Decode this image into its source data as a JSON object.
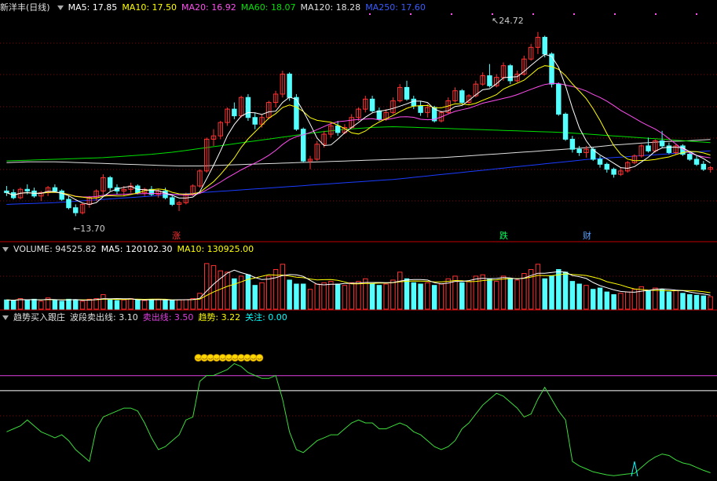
{
  "colors": {
    "up": "#ff3232",
    "down": "#54ffff",
    "ma5": "#ffffff",
    "ma10": "#ffff00",
    "ma20": "#ff4ef0",
    "ma60": "#00e000",
    "ma120": "#e0e0e0",
    "ma250": "#1a3cff",
    "osc": "#3cdc3c",
    "sell": "#e040e0",
    "trend": "#ffff00",
    "watch": "#00ffff",
    "grid": "#8b0000",
    "sep": "#c00000",
    "marker": "#ffd700"
  },
  "price_header": {
    "stock": "新洋丰(日线)",
    "ma5": "MA5: 17.85",
    "ma10": "MA10: 17.50",
    "ma20": "MA20: 16.92",
    "ma60": "MA60: 18.07",
    "ma120": "MA120: 18.28",
    "ma250": "MA250: 17.60"
  },
  "volume_header": {
    "name": "VOLUME: 94525.82",
    "ma5": "MA5: 120102.30",
    "ma10": "MA10: 130925.00"
  },
  "indicator_header": {
    "name": "趋势买入跟庄",
    "wave_sell": "波段卖出线: 3.10",
    "sell_line": "卖出线: 3.50",
    "trend": "趋势: 3.22",
    "watch": "关注: 0.00"
  },
  "annotations": {
    "high": "24.72",
    "low": "13.70",
    "zhang": "涨",
    "die": "跌",
    "cai": "财"
  },
  "chart_data": [
    {
      "type": "candlestick",
      "note_series": "daily OHLC, oldest to newest",
      "ylim": [
        13.2,
        25.6
      ],
      "high_label": 24.72,
      "low_label": 13.7,
      "ohlc": [
        [
          15.2,
          15.5,
          14.9,
          15.1
        ],
        [
          15.1,
          15.3,
          14.7,
          14.8
        ],
        [
          14.8,
          15.4,
          14.7,
          15.3
        ],
        [
          15.3,
          15.6,
          15.0,
          15.2
        ],
        [
          15.2,
          15.4,
          14.8,
          14.9
        ],
        [
          14.9,
          15.2,
          14.6,
          15.1
        ],
        [
          15.1,
          15.5,
          14.9,
          15.4
        ],
        [
          15.4,
          15.6,
          15.1,
          15.2
        ],
        [
          15.2,
          15.3,
          14.6,
          14.7
        ],
        [
          14.7,
          14.9,
          14.1,
          14.2
        ],
        [
          14.2,
          14.4,
          13.7,
          13.9
        ],
        [
          13.9,
          14.5,
          13.8,
          14.4
        ],
        [
          14.4,
          14.9,
          14.2,
          14.8
        ],
        [
          14.8,
          15.3,
          14.6,
          15.2
        ],
        [
          15.2,
          16.2,
          15.0,
          16.0
        ],
        [
          16.0,
          16.1,
          15.2,
          15.4
        ],
        [
          15.4,
          15.6,
          15.0,
          15.2
        ],
        [
          15.2,
          15.5,
          14.9,
          15.3
        ],
        [
          15.3,
          15.7,
          15.1,
          15.5
        ],
        [
          15.5,
          15.6,
          15.0,
          15.1
        ],
        [
          15.1,
          15.4,
          14.9,
          15.3
        ],
        [
          15.3,
          15.5,
          14.9,
          15.0
        ],
        [
          15.0,
          15.3,
          14.8,
          15.2
        ],
        [
          15.2,
          15.4,
          14.7,
          14.8
        ],
        [
          14.8,
          14.9,
          14.3,
          14.4
        ],
        [
          14.4,
          14.6,
          14.0,
          14.5
        ],
        [
          14.5,
          15.1,
          14.4,
          15.0
        ],
        [
          15.0,
          15.6,
          14.9,
          15.5
        ],
        [
          15.5,
          16.5,
          15.4,
          16.4
        ],
        [
          16.4,
          18.4,
          16.3,
          18.3
        ],
        [
          18.3,
          18.9,
          17.9,
          18.5
        ],
        [
          18.5,
          19.4,
          18.3,
          19.3
        ],
        [
          19.3,
          20.2,
          19.1,
          20.1
        ],
        [
          20.1,
          20.5,
          19.5,
          19.7
        ],
        [
          19.7,
          20.9,
          19.6,
          20.8
        ],
        [
          20.8,
          21.0,
          19.4,
          19.6
        ],
        [
          19.6,
          19.9,
          18.9,
          19.2
        ],
        [
          19.2,
          19.8,
          19.0,
          19.6
        ],
        [
          19.6,
          20.6,
          19.5,
          20.5
        ],
        [
          20.5,
          21.2,
          20.2,
          21.0
        ],
        [
          21.0,
          22.4,
          20.8,
          22.2
        ],
        [
          22.2,
          22.3,
          20.6,
          20.8
        ],
        [
          20.8,
          21.0,
          18.8,
          18.9
        ],
        [
          18.9,
          19.0,
          16.9,
          17.0
        ],
        [
          17.0,
          17.3,
          16.5,
          17.1
        ],
        [
          17.1,
          18.2,
          17.0,
          18.0
        ],
        [
          18.0,
          18.8,
          17.8,
          18.6
        ],
        [
          18.6,
          19.3,
          18.4,
          19.1
        ],
        [
          19.1,
          19.4,
          18.5,
          18.7
        ],
        [
          18.7,
          19.2,
          18.6,
          19.0
        ],
        [
          19.0,
          19.8,
          18.9,
          19.6
        ],
        [
          19.6,
          20.2,
          19.4,
          20.1
        ],
        [
          20.1,
          20.9,
          19.9,
          20.7
        ],
        [
          20.7,
          20.9,
          19.9,
          20.0
        ],
        [
          20.0,
          20.2,
          19.4,
          19.5
        ],
        [
          19.5,
          20.1,
          19.4,
          19.9
        ],
        [
          19.9,
          20.8,
          19.8,
          20.6
        ],
        [
          20.6,
          21.6,
          20.5,
          21.4
        ],
        [
          21.4,
          21.8,
          20.6,
          20.7
        ],
        [
          20.7,
          20.9,
          20.1,
          20.3
        ],
        [
          20.3,
          20.6,
          19.7,
          19.9
        ],
        [
          19.9,
          20.4,
          19.6,
          20.2
        ],
        [
          20.2,
          20.3,
          19.3,
          19.4
        ],
        [
          19.4,
          20.0,
          19.3,
          19.9
        ],
        [
          19.9,
          20.8,
          19.8,
          20.6
        ],
        [
          20.6,
          21.4,
          20.5,
          21.2
        ],
        [
          21.2,
          21.3,
          20.4,
          20.5
        ],
        [
          20.5,
          21.0,
          20.4,
          20.9
        ],
        [
          20.9,
          21.8,
          20.8,
          21.6
        ],
        [
          21.6,
          22.3,
          21.5,
          22.1
        ],
        [
          22.1,
          22.8,
          21.4,
          21.5
        ],
        [
          21.5,
          22.2,
          21.4,
          22.0
        ],
        [
          22.0,
          22.9,
          21.8,
          22.7
        ],
        [
          22.7,
          22.8,
          21.6,
          21.8
        ],
        [
          21.8,
          22.4,
          21.7,
          22.2
        ],
        [
          22.2,
          23.3,
          22.1,
          23.1
        ],
        [
          23.1,
          24.0,
          23.0,
          23.8
        ],
        [
          23.8,
          24.72,
          23.4,
          24.4
        ],
        [
          24.4,
          24.5,
          23.2,
          23.4
        ],
        [
          23.4,
          23.5,
          21.4,
          21.6
        ],
        [
          21.6,
          21.7,
          19.7,
          19.8
        ],
        [
          19.8,
          19.9,
          18.2,
          18.3
        ],
        [
          18.3,
          18.5,
          17.5,
          17.7
        ],
        [
          17.7,
          17.9,
          17.3,
          17.5
        ],
        [
          17.5,
          17.9,
          17.2,
          17.7
        ],
        [
          17.7,
          17.8,
          17.0,
          17.1
        ],
        [
          17.1,
          17.3,
          16.6,
          16.8
        ],
        [
          16.8,
          16.9,
          16.3,
          16.5
        ],
        [
          16.5,
          16.6,
          16.0,
          16.2
        ],
        [
          16.2,
          16.6,
          16.1,
          16.4
        ],
        [
          16.4,
          17.0,
          16.3,
          16.9
        ],
        [
          16.9,
          17.4,
          16.8,
          17.3
        ],
        [
          17.3,
          18.0,
          17.2,
          17.9
        ],
        [
          17.9,
          18.4,
          17.5,
          17.6
        ],
        [
          17.6,
          18.3,
          17.5,
          18.2
        ],
        [
          18.2,
          18.8,
          17.8,
          17.9
        ],
        [
          17.9,
          18.1,
          17.4,
          17.5
        ],
        [
          17.5,
          18.0,
          17.4,
          17.9
        ],
        [
          17.9,
          18.0,
          17.3,
          17.4
        ],
        [
          17.4,
          17.6,
          17.0,
          17.1
        ],
        [
          17.1,
          17.3,
          16.7,
          16.8
        ],
        [
          16.8,
          17.0,
          16.4,
          16.5
        ],
        [
          16.5,
          16.7,
          16.3,
          16.6
        ]
      ],
      "ma_windows": {
        "ma5": 5,
        "ma10": 10,
        "ma20": 20
      },
      "ma60": [
        17.0,
        17.05,
        17.1,
        17.15,
        17.2,
        17.3,
        17.4,
        17.55,
        17.75,
        17.95,
        18.15,
        18.35,
        18.55,
        18.75,
        18.9,
        19.0,
        19.05,
        19.0,
        18.95,
        18.9,
        18.85,
        18.8,
        18.75,
        18.7,
        18.6,
        18.5,
        18.4,
        18.3,
        18.2,
        18.1
      ],
      "ma120": [
        16.9,
        16.95,
        16.95,
        16.9,
        16.85,
        16.8,
        16.75,
        16.7,
        16.7,
        16.75,
        16.8,
        16.85,
        16.9,
        16.95,
        17.0,
        17.05,
        17.1,
        17.15,
        17.2,
        17.3,
        17.4,
        17.5,
        17.6,
        17.7,
        17.8,
        17.95,
        18.05,
        18.15,
        18.2,
        18.28
      ],
      "ma250": [
        14.4,
        14.45,
        14.5,
        14.6,
        14.7,
        14.8,
        14.9,
        15.0,
        15.1,
        15.2,
        15.3,
        15.4,
        15.5,
        15.6,
        15.7,
        15.8,
        15.9,
        16.05,
        16.2,
        16.35,
        16.5,
        16.65,
        16.8,
        16.95,
        17.1,
        17.2,
        17.3,
        17.4,
        17.5,
        17.6
      ]
    },
    {
      "type": "bar",
      "title": "VOLUME",
      "ylim": [
        0,
        380000
      ],
      "values": [
        70000,
        65000,
        80000,
        70000,
        75000,
        60000,
        85000,
        70000,
        60000,
        75000,
        72000,
        60000,
        75000,
        80000,
        110000,
        70000,
        65000,
        70000,
        80000,
        70000,
        65000,
        70000,
        75000,
        72000,
        68000,
        70000,
        72000,
        80000,
        120000,
        345000,
        330000,
        290000,
        280000,
        230000,
        250000,
        260000,
        180000,
        200000,
        250000,
        300000,
        340000,
        220000,
        190000,
        190000,
        150000,
        190000,
        200000,
        210000,
        190000,
        180000,
        200000,
        210000,
        230000,
        190000,
        180000,
        190000,
        220000,
        280000,
        230000,
        200000,
        190000,
        200000,
        180000,
        190000,
        230000,
        250000,
        200000,
        210000,
        250000,
        260000,
        230000,
        210000,
        250000,
        230000,
        220000,
        270000,
        300000,
        340000,
        230000,
        250000,
        300000,
        280000,
        210000,
        190000,
        180000,
        150000,
        160000,
        130000,
        110000,
        120000,
        130000,
        150000,
        170000,
        140000,
        160000,
        150000,
        130000,
        140000,
        120000,
        110000,
        105000,
        100000,
        94525.82
      ]
    },
    {
      "type": "line",
      "title": "趋势买入跟庄",
      "ylim": [
        0,
        5
      ],
      "sell_line": 3.5,
      "wave_sell_line": 3.1,
      "values": [
        1.5,
        1.6,
        1.7,
        1.9,
        1.7,
        1.5,
        1.4,
        1.3,
        1.4,
        1.2,
        0.9,
        0.7,
        0.5,
        1.6,
        2.0,
        2.1,
        2.2,
        2.3,
        2.3,
        2.2,
        1.8,
        1.3,
        0.9,
        1.0,
        1.2,
        1.4,
        1.9,
        2.0,
        3.2,
        3.4,
        3.4,
        3.5,
        3.6,
        3.8,
        3.7,
        3.5,
        3.4,
        3.3,
        3.3,
        3.4,
        2.6,
        1.5,
        0.9,
        0.8,
        1.0,
        1.2,
        1.3,
        1.4,
        1.4,
        1.6,
        1.8,
        1.9,
        1.8,
        1.8,
        1.6,
        1.6,
        1.7,
        1.8,
        1.7,
        1.5,
        1.4,
        1.2,
        1.0,
        0.9,
        1.0,
        1.2,
        1.6,
        1.8,
        2.1,
        2.4,
        2.6,
        2.8,
        2.7,
        2.5,
        2.3,
        2.0,
        2.1,
        2.6,
        3.0,
        2.6,
        2.2,
        1.9,
        0.5,
        0.35,
        0.25,
        0.15,
        0.1,
        0.05,
        0.02,
        0.05,
        0.08,
        0.1,
        0.3,
        0.5,
        0.65,
        0.75,
        0.7,
        0.55,
        0.45,
        0.4,
        0.3,
        0.2,
        0.12
      ],
      "markers": {
        "start": 28,
        "count": 11
      },
      "spike": {
        "index": 91,
        "value": 0.5
      }
    }
  ]
}
